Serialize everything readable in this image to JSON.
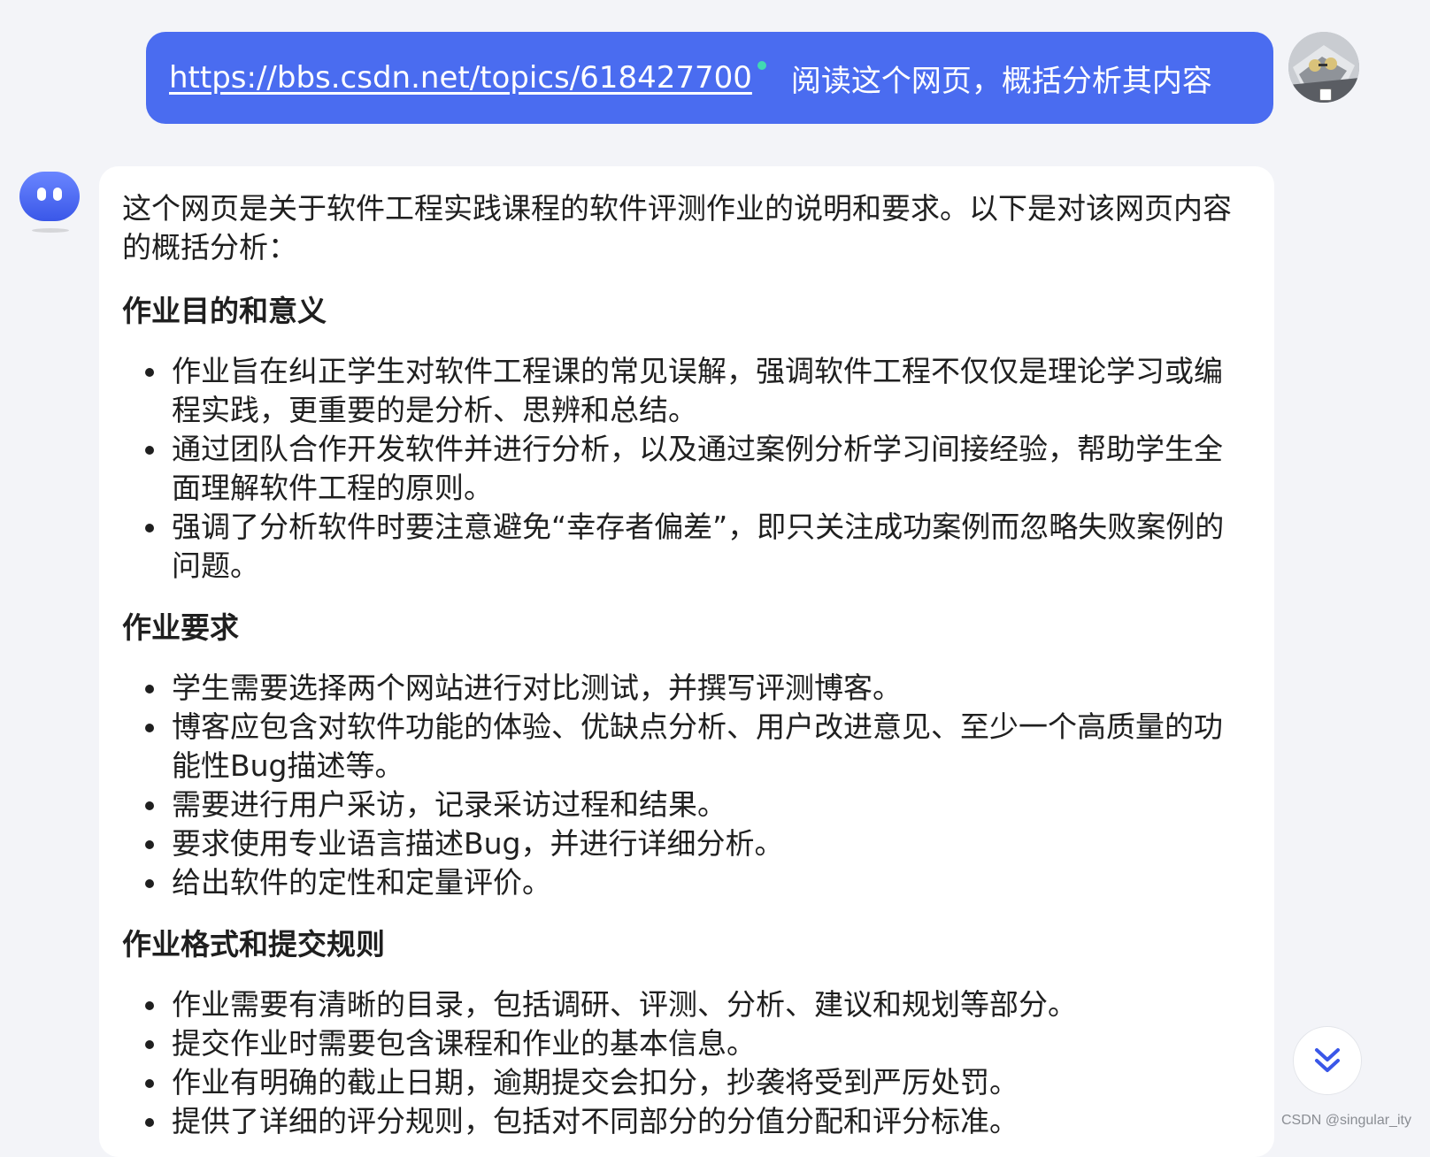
{
  "user_message": {
    "link": "https://bbs.csdn.net/topics/618427700",
    "text": "阅读这个网页，概括分析其内容",
    "bubble_color": "#4a6cf0"
  },
  "reply": {
    "intro": "这个网页是关于软件工程实践课程的软件评测作业的说明和要求。以下是对该网页内容的概括分析：",
    "sections": [
      {
        "heading": "作业目的和意义",
        "items": [
          "作业旨在纠正学生对软件工程课的常见误解，强调软件工程不仅仅是理论学习或编程实践，更重要的是分析、思辨和总结。",
          "通过团队合作开发软件并进行分析，以及通过案例分析学习间接经验，帮助学生全面理解软件工程的原则。",
          "强调了分析软件时要注意避免“幸存者偏差”，即只关注成功案例而忽略失败案例的问题。"
        ]
      },
      {
        "heading": "作业要求",
        "items": [
          "学生需要选择两个网站进行对比测试，并撰写评测博客。",
          "博客应包含对软件功能的体验、优缺点分析、用户改进意见、至少一个高质量的功能性Bug描述等。",
          "需要进行用户采访，记录采访过程和结果。",
          "要求使用专业语言描述Bug，并进行详细分析。",
          "给出软件的定性和定量评价。"
        ]
      },
      {
        "heading": "作业格式和提交规则",
        "items": [
          "作业需要有清晰的目录，包括调研、评测、分析、建议和规划等部分。",
          "提交作业时需要包含课程和作业的基本信息。",
          "作业有明确的截止日期，逾期提交会扣分，抄袭将受到严厉处罚。",
          "提供了详细的评分规则，包括对不同部分的分值分配和评分标准。"
        ]
      }
    ]
  },
  "scroll_button": {
    "icon": "double-chevron-down-icon",
    "color": "#3a57e8"
  },
  "watermark": "CSDN @singular_ity"
}
